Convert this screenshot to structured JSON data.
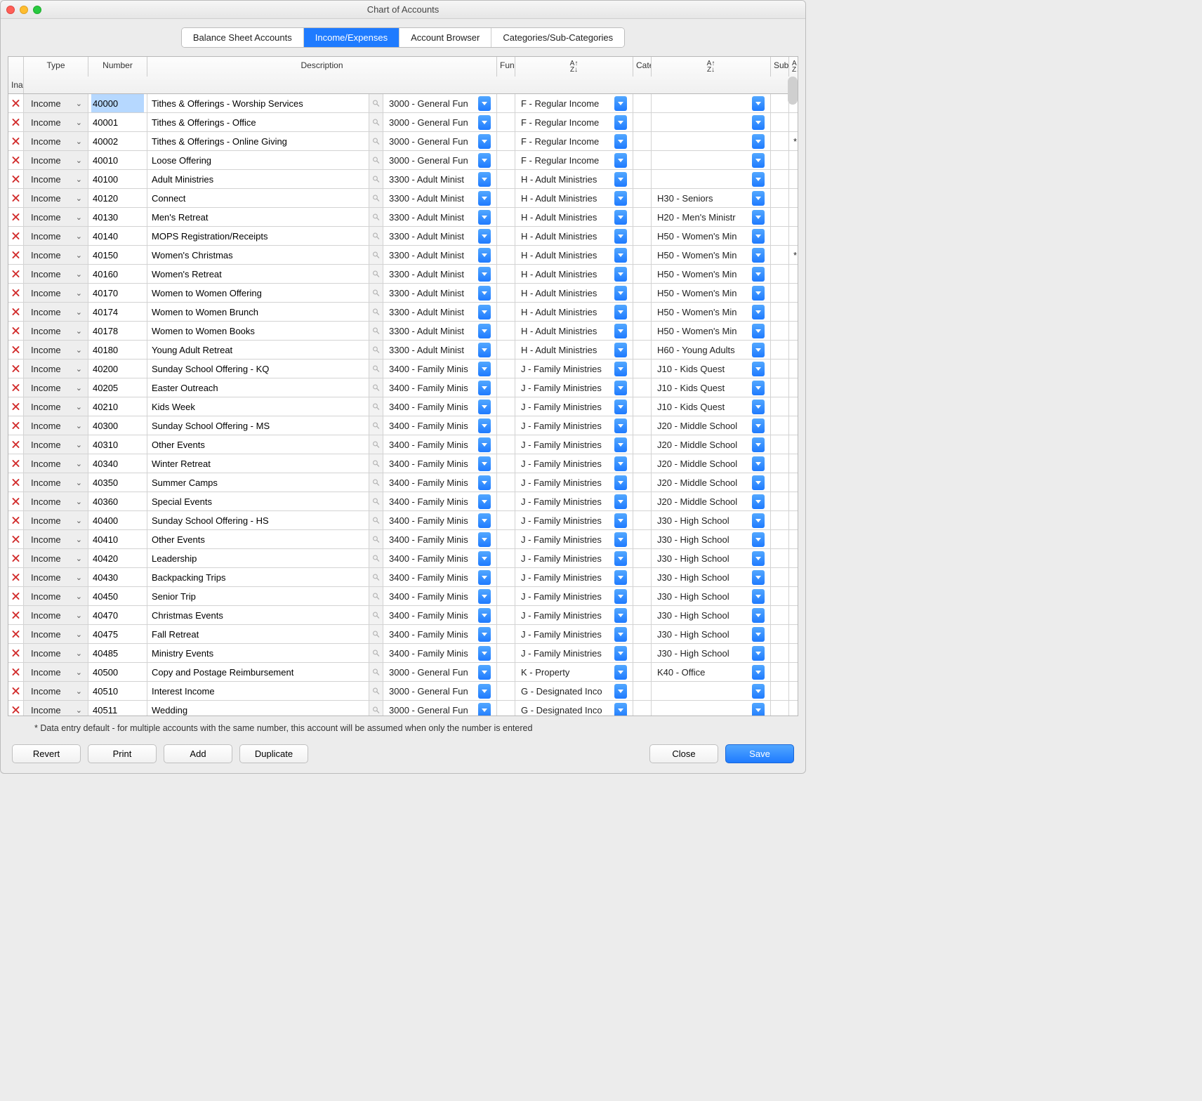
{
  "window": {
    "title": "Chart of Accounts"
  },
  "tabs": [
    "Balance Sheet Accounts",
    "Income/Expenses",
    "Account Browser",
    "Categories/Sub-Categories"
  ],
  "active_tab": 1,
  "columns": {
    "type": "Type",
    "number": "Number",
    "description": "Description",
    "fund_balance": "Fund Balance",
    "category": "Category",
    "sub_category": "Sub-Category",
    "star": "*",
    "inact": "Inact.",
    "sort_glyph": "A↑\nZ↓"
  },
  "selected_row": 0,
  "rows": [
    {
      "type": "Income",
      "number": "40000",
      "desc": "Tithes & Offerings - Worship Services",
      "fund": "3000 - General Fun",
      "cat": "F - Regular Income",
      "sub": "",
      "star": "",
      "inact": false
    },
    {
      "type": "Income",
      "number": "40001",
      "desc": "Tithes & Offerings - Office",
      "fund": "3000 - General Fun",
      "cat": "F - Regular Income",
      "sub": "",
      "star": "",
      "inact": false
    },
    {
      "type": "Income",
      "number": "40002",
      "desc": "Tithes & Offerings - Online Giving",
      "fund": "3000 - General Fun",
      "cat": "F - Regular Income",
      "sub": "",
      "star": "*",
      "inact": false
    },
    {
      "type": "Income",
      "number": "40010",
      "desc": "Loose Offering",
      "fund": "3000 - General Fun",
      "cat": "F - Regular Income",
      "sub": "",
      "star": "",
      "inact": false
    },
    {
      "type": "Income",
      "number": "40100",
      "desc": "Adult Ministries",
      "fund": "3300 - Adult Minist",
      "cat": "H - Adult Ministries",
      "sub": "",
      "star": "",
      "inact": false
    },
    {
      "type": "Income",
      "number": "40120",
      "desc": "Connect",
      "fund": "3300 - Adult Minist",
      "cat": "H - Adult Ministries",
      "sub": "H30 - Seniors",
      "star": "",
      "inact": false
    },
    {
      "type": "Income",
      "number": "40130",
      "desc": "Men's Retreat",
      "fund": "3300 - Adult Minist",
      "cat": "H - Adult Ministries",
      "sub": "H20 - Men's Ministr",
      "star": "",
      "inact": false
    },
    {
      "type": "Income",
      "number": "40140",
      "desc": "MOPS Registration/Receipts",
      "fund": "3300 - Adult Minist",
      "cat": "H - Adult Ministries",
      "sub": "H50 - Women's Min",
      "star": "",
      "inact": false
    },
    {
      "type": "Income",
      "number": "40150",
      "desc": "Women's Christmas",
      "fund": "3300 - Adult Minist",
      "cat": "H - Adult Ministries",
      "sub": "H50 - Women's Min",
      "star": "*",
      "inact": false
    },
    {
      "type": "Income",
      "number": "40160",
      "desc": "Women's Retreat",
      "fund": "3300 - Adult Minist",
      "cat": "H - Adult Ministries",
      "sub": "H50 - Women's Min",
      "star": "",
      "inact": false
    },
    {
      "type": "Income",
      "number": "40170",
      "desc": "Women to Women Offering",
      "fund": "3300 - Adult Minist",
      "cat": "H - Adult Ministries",
      "sub": "H50 - Women's Min",
      "star": "",
      "inact": false
    },
    {
      "type": "Income",
      "number": "40174",
      "desc": "Women to Women Brunch",
      "fund": "3300 - Adult Minist",
      "cat": "H - Adult Ministries",
      "sub": "H50 - Women's Min",
      "star": "",
      "inact": false
    },
    {
      "type": "Income",
      "number": "40178",
      "desc": "Women to Women Books",
      "fund": "3300 - Adult Minist",
      "cat": "H - Adult Ministries",
      "sub": "H50 - Women's Min",
      "star": "",
      "inact": false
    },
    {
      "type": "Income",
      "number": "40180",
      "desc": "Young Adult Retreat",
      "fund": "3300 - Adult Minist",
      "cat": "H - Adult Ministries",
      "sub": "H60 - Young Adults",
      "star": "",
      "inact": false
    },
    {
      "type": "Income",
      "number": "40200",
      "desc": "Sunday School Offering - KQ",
      "fund": "3400 - Family Minis",
      "cat": "J - Family Ministries",
      "sub": "J10 - Kids Quest",
      "star": "",
      "inact": false
    },
    {
      "type": "Income",
      "number": "40205",
      "desc": "Easter Outreach",
      "fund": "3400 - Family Minis",
      "cat": "J - Family Ministries",
      "sub": "J10 - Kids Quest",
      "star": "",
      "inact": false
    },
    {
      "type": "Income",
      "number": "40210",
      "desc": "Kids Week",
      "fund": "3400 - Family Minis",
      "cat": "J - Family Ministries",
      "sub": "J10 - Kids Quest",
      "star": "",
      "inact": false
    },
    {
      "type": "Income",
      "number": "40300",
      "desc": "Sunday School Offering - MS",
      "fund": "3400 - Family Minis",
      "cat": "J - Family Ministries",
      "sub": "J20 - Middle School",
      "star": "",
      "inact": false
    },
    {
      "type": "Income",
      "number": "40310",
      "desc": "Other Events",
      "fund": "3400 - Family Minis",
      "cat": "J - Family Ministries",
      "sub": "J20 - Middle School",
      "star": "",
      "inact": false
    },
    {
      "type": "Income",
      "number": "40340",
      "desc": "Winter Retreat",
      "fund": "3400 - Family Minis",
      "cat": "J - Family Ministries",
      "sub": "J20 - Middle School",
      "star": "",
      "inact": false
    },
    {
      "type": "Income",
      "number": "40350",
      "desc": "Summer Camps",
      "fund": "3400 - Family Minis",
      "cat": "J - Family Ministries",
      "sub": "J20 - Middle School",
      "star": "",
      "inact": false
    },
    {
      "type": "Income",
      "number": "40360",
      "desc": "Special Events",
      "fund": "3400 - Family Minis",
      "cat": "J - Family Ministries",
      "sub": "J20 - Middle School",
      "star": "",
      "inact": false
    },
    {
      "type": "Income",
      "number": "40400",
      "desc": "Sunday School Offering - HS",
      "fund": "3400 - Family Minis",
      "cat": "J - Family Ministries",
      "sub": "J30 - High School",
      "star": "",
      "inact": false
    },
    {
      "type": "Income",
      "number": "40410",
      "desc": "Other Events",
      "fund": "3400 - Family Minis",
      "cat": "J - Family Ministries",
      "sub": "J30 - High School",
      "star": "",
      "inact": false
    },
    {
      "type": "Income",
      "number": "40420",
      "desc": "Leadership",
      "fund": "3400 - Family Minis",
      "cat": "J - Family Ministries",
      "sub": "J30 - High School",
      "star": "",
      "inact": false
    },
    {
      "type": "Income",
      "number": "40430",
      "desc": "Backpacking Trips",
      "fund": "3400 - Family Minis",
      "cat": "J - Family Ministries",
      "sub": "J30 - High School",
      "star": "",
      "inact": false
    },
    {
      "type": "Income",
      "number": "40450",
      "desc": "Senior Trip",
      "fund": "3400 - Family Minis",
      "cat": "J - Family Ministries",
      "sub": "J30 - High School",
      "star": "",
      "inact": false
    },
    {
      "type": "Income",
      "number": "40470",
      "desc": "Christmas Events",
      "fund": "3400 - Family Minis",
      "cat": "J - Family Ministries",
      "sub": "J30 - High School",
      "star": "",
      "inact": false
    },
    {
      "type": "Income",
      "number": "40475",
      "desc": "Fall Retreat",
      "fund": "3400 - Family Minis",
      "cat": "J - Family Ministries",
      "sub": "J30 - High School",
      "star": "",
      "inact": false
    },
    {
      "type": "Income",
      "number": "40485",
      "desc": "Ministry Events",
      "fund": "3400 - Family Minis",
      "cat": "J - Family Ministries",
      "sub": "J30 - High School",
      "star": "",
      "inact": false
    },
    {
      "type": "Income",
      "number": "40500",
      "desc": "Copy and Postage Reimbursement",
      "fund": "3000 - General Fun",
      "cat": "K - Property",
      "sub": "K40 - Office",
      "star": "",
      "inact": false
    },
    {
      "type": "Income",
      "number": "40510",
      "desc": "Interest Income",
      "fund": "3000 - General Fun",
      "cat": "G - Designated Inco",
      "sub": "",
      "star": "",
      "inact": false
    },
    {
      "type": "Income",
      "number": "40511",
      "desc": "Wedding",
      "fund": "3000 - General Fun",
      "cat": "G - Designated Inco",
      "sub": "",
      "star": "",
      "inact": false
    }
  ],
  "footnote": "* Data entry default - for multiple accounts with the same number, this account will be assumed when only the number is entered",
  "buttons": {
    "revert": "Revert",
    "print": "Print",
    "add": "Add",
    "duplicate": "Duplicate",
    "close": "Close",
    "save": "Save"
  }
}
